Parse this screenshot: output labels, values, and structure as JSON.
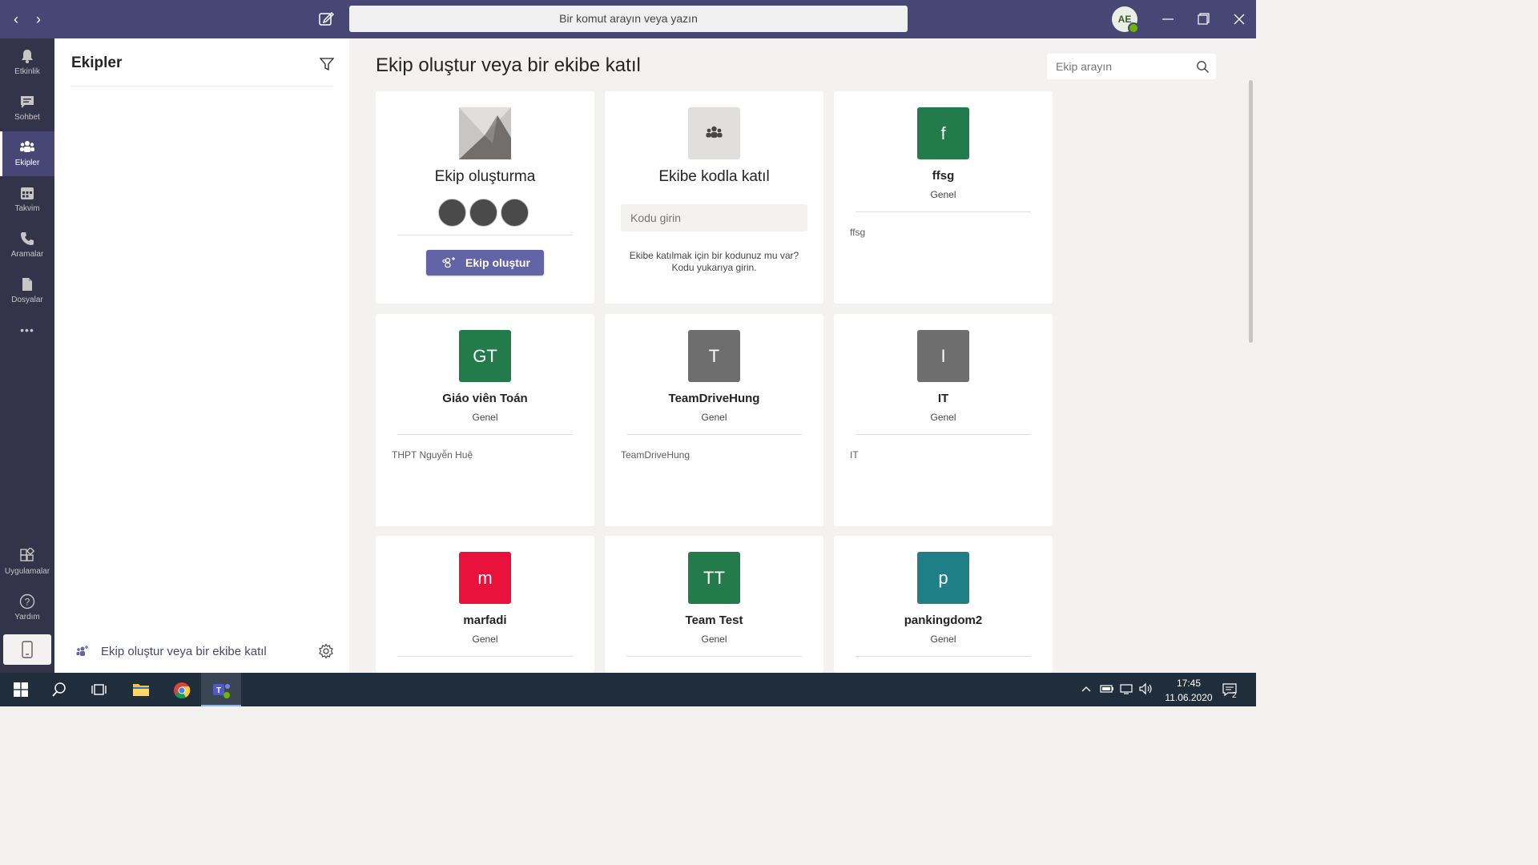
{
  "titlebar": {
    "search_placeholder": "Bir komut arayın veya yazın",
    "avatar_initials": "AE",
    "nav_back": "‹",
    "nav_forward": "›"
  },
  "rail": {
    "items": [
      {
        "label": "Etkinlik",
        "icon": "bell-icon"
      },
      {
        "label": "Sohbet",
        "icon": "chat-icon"
      },
      {
        "label": "Ekipler",
        "icon": "teams-icon"
      },
      {
        "label": "Takvim",
        "icon": "calendar-icon"
      },
      {
        "label": "Aramalar",
        "icon": "phone-icon"
      },
      {
        "label": "Dosyalar",
        "icon": "file-icon"
      }
    ],
    "more": "•••",
    "bottom": [
      {
        "label": "Uygulamalar",
        "icon": "apps-icon"
      },
      {
        "label": "Yardım",
        "icon": "help-icon"
      }
    ]
  },
  "panel": {
    "title": "Ekipler",
    "footer_link": "Ekip oluştur veya bir ekibe katıl"
  },
  "main": {
    "title": "Ekip oluştur veya bir ekibe katıl",
    "search_placeholder": "Ekip arayın",
    "create_card": {
      "title": "Ekip oluşturma",
      "button": "Ekip oluştur"
    },
    "join_card": {
      "title": "Ekibe kodla katıl",
      "input_placeholder": "Kodu girin",
      "hint_line1": "Ekibe katılmak için bir kodunuz mu var?",
      "hint_line2": "Kodu yukarıya girin."
    },
    "teams": [
      {
        "initials": "f",
        "name": "ffsg",
        "channel": "Genel",
        "description": "ffsg",
        "color": "#237b4b"
      },
      {
        "initials": "GT",
        "name": "Giáo viên Toán",
        "channel": "Genel",
        "description": "THPT Nguyễn Huệ",
        "color": "#237b4b"
      },
      {
        "initials": "T",
        "name": "TeamDriveHung",
        "channel": "Genel",
        "description": "TeamDriveHung",
        "color": "#6e6e6e"
      },
      {
        "initials": "I",
        "name": "IT",
        "channel": "Genel",
        "description": "IT",
        "color": "#6e6e6e"
      },
      {
        "initials": "m",
        "name": "marfadi",
        "channel": "Genel",
        "description": "",
        "color": "#e8123c"
      },
      {
        "initials": "TT",
        "name": "Team Test",
        "channel": "Genel",
        "description": "",
        "color": "#237b4b"
      },
      {
        "initials": "p",
        "name": "pankingdom2",
        "channel": "Genel",
        "description": "",
        "color": "#1e7f86"
      }
    ]
  },
  "taskbar": {
    "time": "17:45",
    "date": "11.06.2020",
    "notification_count": "2"
  },
  "colors": {
    "titlebar": "#464775",
    "rail": "#33344a",
    "accent": "#6264a7"
  }
}
